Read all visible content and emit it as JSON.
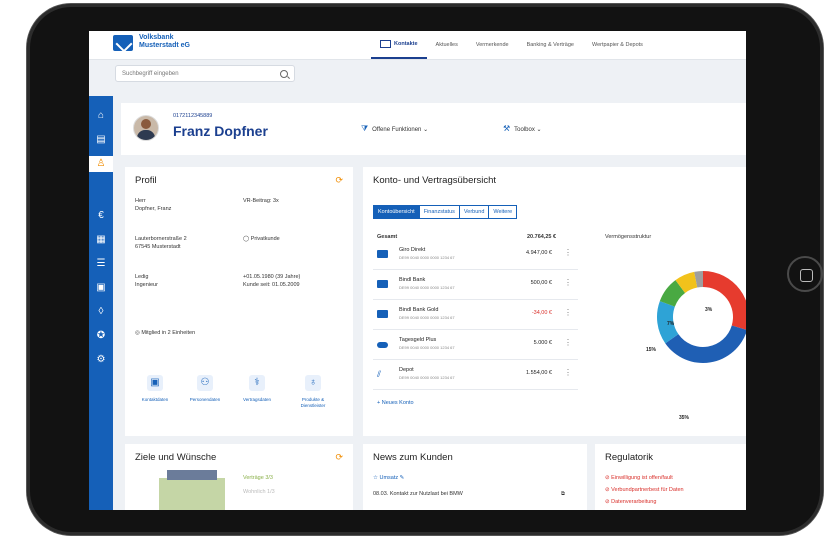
{
  "bank": {
    "name_line1": "Volksbank",
    "name_line2": "Musterstadt eG"
  },
  "top_tabs": [
    {
      "label": "Kontakte",
      "active": true
    },
    {
      "label": "Aktuelles"
    },
    {
      "label": "Vermerkende"
    },
    {
      "label": "Banking & Verträge"
    },
    {
      "label": "Wertpapier & Depots"
    }
  ],
  "search": {
    "placeholder": "Suchbegriff eingeben"
  },
  "customer": {
    "id": "0172112345889",
    "name": "Franz Dopfner"
  },
  "header_actions": {
    "notices": "Offene Funktionen",
    "tools": "Toolbox"
  },
  "profile": {
    "title": "Profil",
    "rows": [
      {
        "left": "Herr\nDopfner, Franz",
        "right": "VR-Beitrag: 3x"
      },
      {
        "left": "Lauterbornerstraße 2\n67545 Musterstadt",
        "right": "Privatkunde"
      },
      {
        "left": "Ledig\nIngenieur",
        "right": "+01.05.1980 (39 Jahre)\nKunde seit: 01.05.2009"
      }
    ],
    "member": "Mitglied in 2 Einheiten",
    "quick": [
      {
        "icon": "terminal-icon",
        "glyph": "▣",
        "label": "Kontaktdaten"
      },
      {
        "icon": "people-icon",
        "glyph": "⚇",
        "label": "Personendaten"
      },
      {
        "icon": "handshake-icon",
        "glyph": "⚕",
        "label": "Vertragsdaten"
      },
      {
        "icon": "bottle-icon",
        "glyph": "♁",
        "label": "Produkte & Dienstleister"
      }
    ]
  },
  "accounts": {
    "title": "Konto- und Vertragsübersicht",
    "tabs": [
      {
        "label": "Kontoübersicht",
        "active": true
      },
      {
        "label": "Finanzstatus"
      },
      {
        "label": "Verbund"
      },
      {
        "label": "Weitere"
      }
    ],
    "total_label": "Gesamt",
    "total_value": "20.764,25 €",
    "chart_label": "Vermögensstruktur",
    "items": [
      {
        "name": "Giro Direkt",
        "iban": "DE99 0040 0000 0000 1234 67",
        "value": "4.947,00 €",
        "negative": false,
        "icon": "card-icon"
      },
      {
        "name": "Bindl Bank",
        "iban": "DE99 0040 0000 0000 1234 67",
        "value": "500,00 €",
        "negative": false,
        "icon": "card-icon"
      },
      {
        "name": "Bindl Bank Gold",
        "iban": "DE99 0040 0000 0000 1234 67",
        "value": "-34,00 €",
        "negative": true,
        "icon": "card-icon"
      },
      {
        "name": "Tagesgeld Plus",
        "iban": "DE99 0040 0000 0000 1234 67",
        "value": "5.000 €",
        "negative": false,
        "icon": "coins-icon"
      },
      {
        "name": "Depot",
        "iban": "DE99 0040 0000 0000 1234 67",
        "value": "1.554,00 €",
        "negative": false,
        "icon": "chart-icon"
      }
    ],
    "new_account": "Neues Konto"
  },
  "donut": {
    "segments": [
      {
        "value": 29,
        "color": "#e63b2e",
        "label": ""
      },
      {
        "value": 35,
        "color": "#1f5fb4",
        "label": "35%"
      },
      {
        "value": 15,
        "color": "#2ea3d6",
        "label": "15%"
      },
      {
        "value": 9,
        "color": "#49a942",
        "label": ""
      },
      {
        "value": 7,
        "color": "#f2c21b",
        "label": "7%"
      },
      {
        "value": 3,
        "color": "#9e9e9e",
        "label": "3%"
      }
    ]
  },
  "goals": {
    "title": "Ziele und Wünsche",
    "line1": "Verträge 3/3",
    "line2": "Wohnlich 1/3"
  },
  "news": {
    "title": "News zum Kunden",
    "tag": "Umsatz",
    "item": "08.03. Kontakt zur Nutzlast bei BMW"
  },
  "reg": {
    "title": "Regulatorik",
    "items": [
      "Einwilligung ist offen/fault",
      "Verbundpartnerbest für Daten",
      "Datenverarbeitung"
    ]
  }
}
